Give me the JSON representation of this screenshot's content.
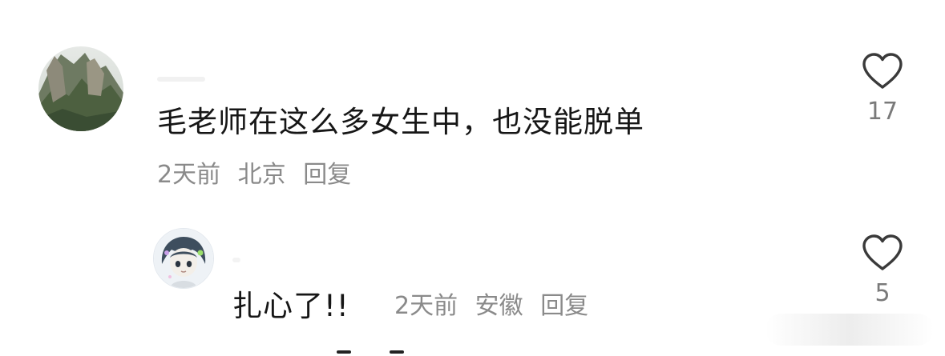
{
  "comments": [
    {
      "text": "毛老师在这么多女生中，也没能脱单",
      "time": "2天前",
      "location": "北京",
      "reply_label": "回复",
      "likes": "17",
      "replies": [
        {
          "text": "扎心了!!",
          "time": "2天前",
          "location": "安徽",
          "reply_label": "回复",
          "likes": "5"
        }
      ]
    }
  ],
  "icons": {
    "like": "heart-outline-icon"
  },
  "colors": {
    "text": "#161616",
    "meta": "#8a8a8a",
    "heart": "#3a3a3a"
  }
}
